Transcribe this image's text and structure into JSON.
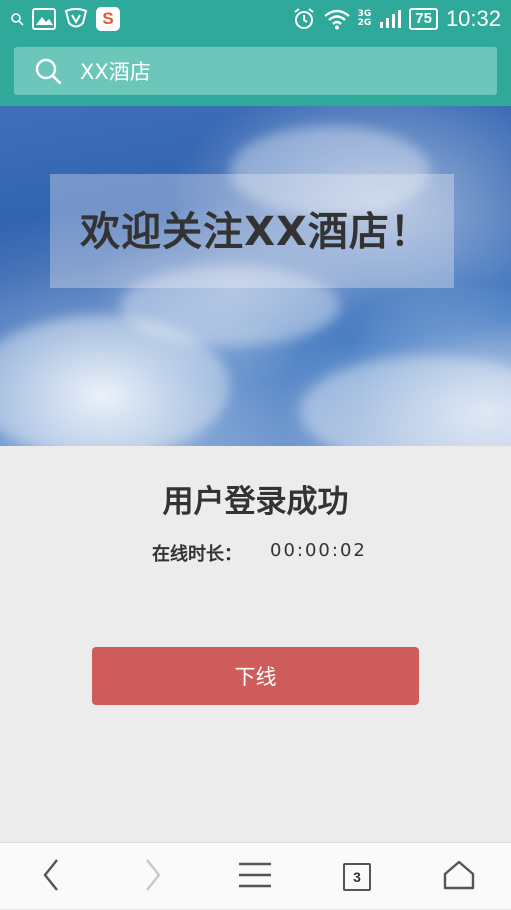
{
  "status_bar": {
    "time": "10:32",
    "battery": "75",
    "network_top": "3G",
    "network_bottom": "2G",
    "icons": [
      "search-icon",
      "gallery-icon",
      "shield-icon",
      "sogou-app-icon",
      "alarm-icon",
      "wifi-icon",
      "signal-icon",
      "battery-icon"
    ],
    "app_letter": "S"
  },
  "search": {
    "text": "XX酒店",
    "icon": "search-icon"
  },
  "banner": {
    "title": "欢迎关注XX酒店！"
  },
  "main": {
    "login_title": "用户登录成功",
    "online_label": "在线时长：",
    "online_value": "00:00:02",
    "logout_label": "下线"
  },
  "bottom_nav": {
    "tab_count": "3",
    "items": [
      "back-icon",
      "forward-icon",
      "menu-icon",
      "tabs-icon",
      "home-icon"
    ]
  },
  "colors": {
    "accent": "#2fa999",
    "logout": "#cd5c5a"
  }
}
